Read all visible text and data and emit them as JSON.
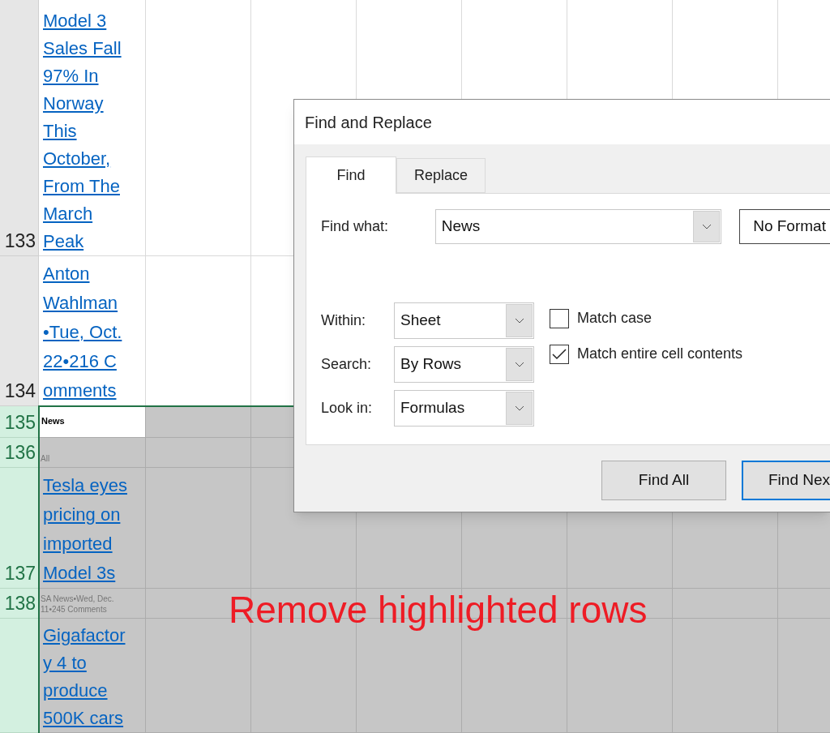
{
  "sheet": {
    "rows": [
      {
        "number": "133",
        "highlighted": false,
        "active": false,
        "cell": {
          "kind": "link",
          "lines": [
            "Model 3",
            "Sales Fall",
            "97% In",
            "Norway",
            "This",
            "October,",
            "From The",
            "March",
            "Peak"
          ]
        }
      },
      {
        "number": "134",
        "highlighted": false,
        "active": false,
        "cell": {
          "kind": "link",
          "lines": [
            "Anton",
            "Wahlman",
            "•Tue, Oct.",
            "22•216 C",
            "omments"
          ]
        }
      },
      {
        "number": "135",
        "highlighted": true,
        "active": true,
        "cell": {
          "kind": "heading",
          "lines": [
            "News"
          ]
        }
      },
      {
        "number": "136",
        "highlighted": true,
        "active": false,
        "cell": {
          "kind": "note",
          "lines": [
            "All"
          ]
        }
      },
      {
        "number": "137",
        "highlighted": true,
        "active": false,
        "cell": {
          "kind": "link",
          "lines": [
            "Tesla eyes",
            "pricing on",
            "imported",
            "Model 3s"
          ]
        }
      },
      {
        "number": "138",
        "highlighted": true,
        "active": false,
        "cell": {
          "kind": "note",
          "lines": [
            "SA News•Wed, Dec.",
            "11•245 Comments"
          ]
        }
      },
      {
        "number": "",
        "highlighted": true,
        "active": false,
        "cell": {
          "kind": "link",
          "lines": [
            "Gigafactor",
            "y 4 to",
            "produce",
            "500K cars"
          ]
        }
      }
    ]
  },
  "dialog": {
    "title": "Find and Replace",
    "tabs": [
      {
        "label": "Find",
        "selected": true
      },
      {
        "label": "Replace",
        "selected": false
      }
    ],
    "find_what": {
      "label": "Find what:",
      "value": "News"
    },
    "format_button": "No Format",
    "dropdowns": [
      {
        "label": "Within:",
        "value": "Sheet"
      },
      {
        "label": "Search:",
        "value": "By Rows"
      },
      {
        "label": "Look in:",
        "value": "Formulas"
      }
    ],
    "checkboxes": [
      {
        "label": "Match case",
        "checked": false
      },
      {
        "label": "Match entire cell contents",
        "checked": true
      }
    ],
    "buttons": [
      {
        "label": "Find All",
        "focused": false
      },
      {
        "label": "Find Nex",
        "focused": true
      }
    ]
  },
  "annotation": "Remove highlighted rows"
}
